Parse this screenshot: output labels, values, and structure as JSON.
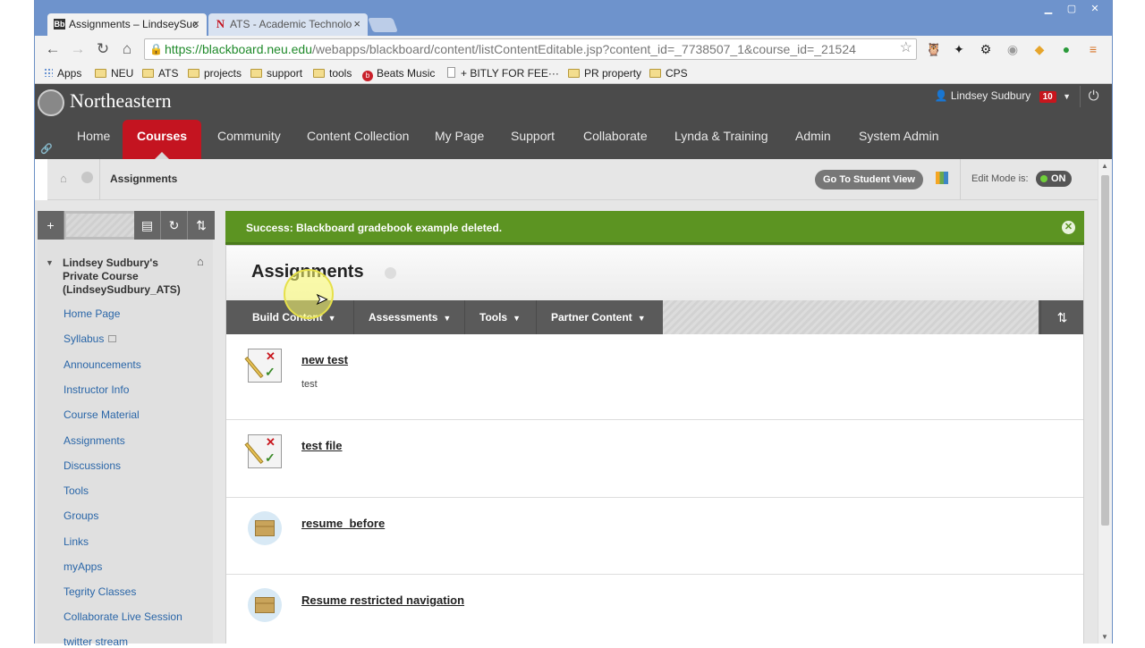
{
  "browser": {
    "tabs": [
      {
        "label": "Assignments – LindseySuc",
        "favicon": "Bb"
      },
      {
        "label": "ATS - Academic Technolo",
        "favicon": "N"
      }
    ],
    "url_host": "https://blackboard.neu.edu",
    "url_path": "/webapps/blackboard/content/listContentEditable.jsp?content_id=_7738507_1&course_id=_21524",
    "bookmarks": [
      "Apps",
      "NEU",
      "ATS",
      "projects",
      "support",
      "tools",
      "Beats Music",
      "+ BITLY FOR FEE···",
      "PR property",
      "CPS"
    ]
  },
  "bb": {
    "logo": "Northeastern",
    "user": "Lindsey Sudbury",
    "notifications": "10",
    "nav": [
      "Home",
      "Courses",
      "Community",
      "Content Collection",
      "My Page",
      "Support",
      "Collaborate",
      "Lynda & Training",
      "Admin",
      "System Admin"
    ],
    "active_nav": "Courses"
  },
  "breadcrumb": {
    "title": "Assignments",
    "student_view": "Go To Student View",
    "edit_mode_label": "Edit Mode is:",
    "edit_mode_value": "ON"
  },
  "sidebar": {
    "course_name": "Lindsey Sudbury's Private Course (LindseySudbury_ATS)",
    "items": [
      "Home Page",
      "Syllabus",
      "Announcements",
      "Instructor Info",
      "Course Material",
      "Assignments",
      "Discussions",
      "Tools",
      "Groups",
      "Links",
      "myApps",
      "Tegrity Classes",
      "Collaborate Live Session",
      "twitter stream"
    ]
  },
  "content": {
    "success": "Success: Blackboard gradebook example deleted.",
    "page_title": "Assignments",
    "actions": [
      "Build Content",
      "Assessments",
      "Tools",
      "Partner Content"
    ],
    "items": [
      {
        "title": "new test",
        "desc": "test",
        "icon": "test-icon"
      },
      {
        "title": "test file",
        "desc": "",
        "icon": "test-icon"
      },
      {
        "title": "resume_before",
        "desc": "",
        "icon": "package-icon"
      },
      {
        "title": "Resume restricted navigation",
        "desc": "",
        "icon": "package-icon"
      }
    ]
  }
}
